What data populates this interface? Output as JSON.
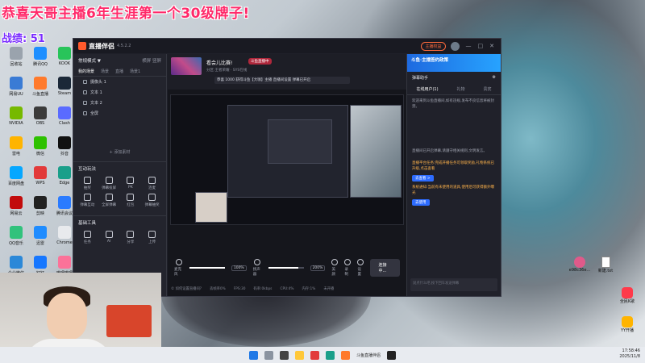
{
  "overlay": {
    "banner": "恭喜天哥主播6年生涯第一个30级牌子!",
    "score_label": "战绩:",
    "score_value": "51"
  },
  "desktop_icons": [
    {
      "label": "回收站"
    },
    {
      "label": "腾讯QQ"
    },
    {
      "label": "KOOK"
    },
    {
      "label": "网易UU"
    },
    {
      "label": "斗鱼直播"
    },
    {
      "label": "Steam"
    },
    {
      "label": "NVIDIA"
    },
    {
      "label": "OBS"
    },
    {
      "label": "Clash"
    },
    {
      "label": "雷电"
    },
    {
      "label": "微信"
    },
    {
      "label": "抖音"
    },
    {
      "label": "百度网盘"
    },
    {
      "label": "WPS"
    },
    {
      "label": "Edge"
    },
    {
      "label": "网易云"
    },
    {
      "label": "剪映"
    },
    {
      "label": "腾讯会议"
    },
    {
      "label": "QQ音乐"
    },
    {
      "label": "迅雷"
    },
    {
      "label": "Chrome"
    },
    {
      "label": "企业微信"
    },
    {
      "label": "钉钉"
    },
    {
      "label": "哔哩哔哩"
    }
  ],
  "right_desktop": [
    {
      "label": "e98c36e..."
    },
    {
      "label": "新建.txt"
    },
    {
      "label": "全民K歌"
    },
    {
      "label": "YY开播"
    }
  ],
  "app": {
    "name": "直播伴侣",
    "version": "4.5.2.2",
    "live_badge": "主播权益",
    "accent": "#ff5a2c",
    "left": {
      "mode_label": "常规模式 ▼",
      "mode_right": "横屏 竖屏",
      "tabs": [
        "我的场景",
        "场景",
        "直播",
        "场景1"
      ],
      "sources": [
        "摄像头 1",
        "文本 1",
        "文本 2",
        "全屏"
      ],
      "add_source": "+ 添加素材",
      "interaction_title": "互动玩法",
      "interactions": [
        "抽奖",
        "弹幕投屏",
        "PK",
        "连麦",
        "弹幕互动",
        "全屏弹幕",
        "红包",
        "弹幕抽奖"
      ],
      "tools_title": "基础工具",
      "tools": [
        "任务",
        "AI",
        "分享",
        "上传"
      ]
    },
    "center": {
      "room_title": "看会儿比赛!",
      "room_tag": "斗鱼直播中",
      "meta": "分区:王者荣耀 · SYS在线",
      "notice": "恭喜 1000 获得斗鱼【大咖】主播 直播间设置 弹幕已开启",
      "controls": {
        "mic_label": "麦克风",
        "mic_pct": "100%",
        "mic_level": 1.0,
        "speaker_label": "扬声器",
        "speaker_pct": "200%",
        "speaker_level": 0.85,
        "icon_labels": [
          "美颜",
          "录制",
          "设置"
        ],
        "go_live": "连接中..."
      },
      "status": [
        "© 如何设置直播间?",
        "丢帧率0%",
        "FPS:30",
        "码率:0kbps",
        "CPU:4%",
        "内存:1%",
        "未开播"
      ]
    },
    "right": {
      "ad": "斗鱼·主播签约政策",
      "helper": "弹幕助手",
      "tabs": [
        "在线用户(1)",
        "礼物",
        "贵宾"
      ],
      "msg1": "欢迎来到斗鱼直播间,如有违规,发布不良信息将被封禁。",
      "msg2": "直播间已开启弹幕,请遵守相关规则,文明发言。",
      "msg3": "直播平台任务:完成开播任务可领取奖励,礼物系统已升级,点击查看",
      "view_btn": "去查看 >",
      "msg4": "系统通知:当前有未使用的道具,使用后可获得额外曝光",
      "use_btn": "去使用",
      "input_placeholder": "说点什么吧,按下回车发送弹幕"
    }
  },
  "taskbar": {
    "app_label": "斗鱼直播伴侣",
    "time": "17:58:46",
    "date": "2025/11/8"
  }
}
